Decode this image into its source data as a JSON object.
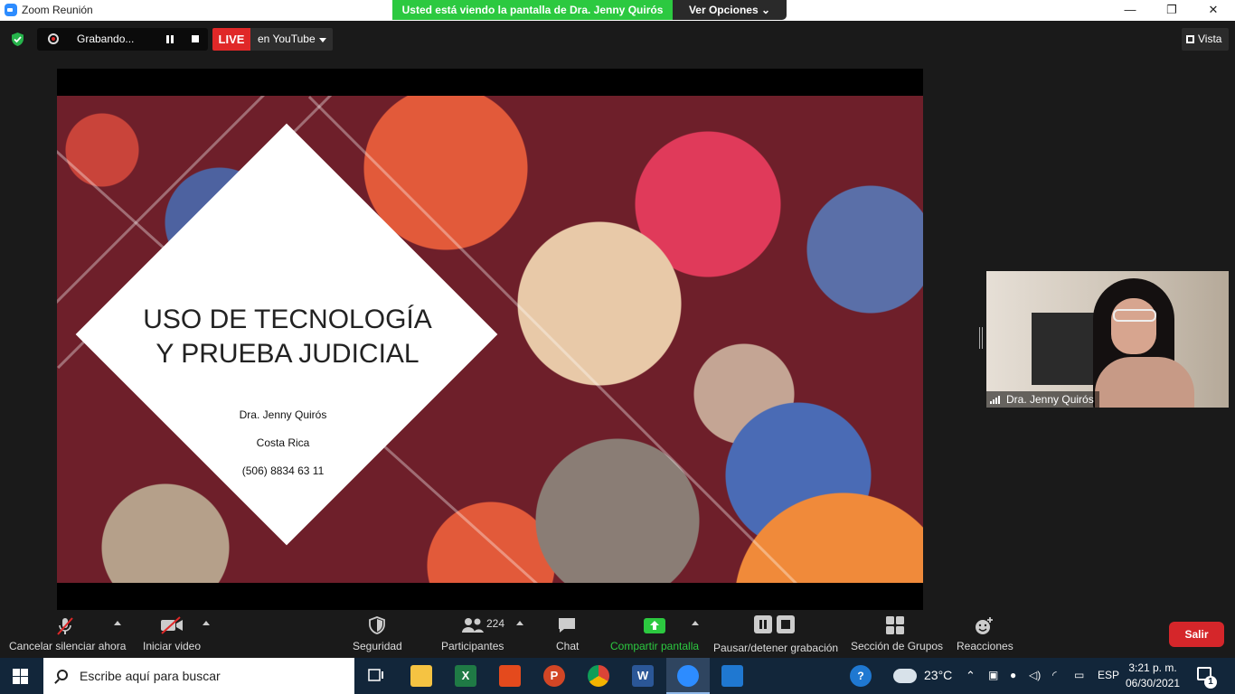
{
  "window": {
    "title": "Zoom Reunión",
    "share_banner": "Usted está viendo la pantalla de Dra. Jenny Quirós",
    "view_options": "Ver Opciones"
  },
  "topbar": {
    "recording_label": "Grabando...",
    "live_label": "LIVE",
    "live_target": "en YouTube",
    "view_label": "Vista"
  },
  "slide": {
    "title_line1": "USO DE TECNOLOGÍA",
    "title_line2": "Y PRUEBA JUDICIAL",
    "author": "Dra. Jenny Quirós",
    "country": "Costa Rica",
    "phone": "(506) 8834 63 11"
  },
  "participant": {
    "name": "Dra. Jenny Quirós"
  },
  "toolbar": {
    "mute_label": "Cancelar silenciar ahora",
    "video_label": "Iniciar video",
    "security_label": "Seguridad",
    "participants_label": "Participantes",
    "participants_count": "224",
    "chat_label": "Chat",
    "share_label": "Compartir pantalla",
    "recording_label": "Pausar/detener grabación",
    "breakout_label": "Sección de Grupos",
    "reactions_label": "Reacciones",
    "leave_label": "Salir"
  },
  "taskbar": {
    "search_placeholder": "Escribe aquí para buscar",
    "weather": "23°C",
    "language": "ESP",
    "time": "3:21 p. m.",
    "date": "06/30/2021",
    "notifications": "1"
  },
  "colors": {
    "share_green": "#2cc940",
    "live_red": "#e02828",
    "leave_red": "#d5262a",
    "taskbar": "#12263a"
  },
  "icons": [
    "zoom-icon",
    "shield-icon",
    "record-icon",
    "pause-icon",
    "stop-icon",
    "microphone-muted-icon",
    "video-muted-icon",
    "security-shield-icon",
    "participants-icon",
    "chat-icon",
    "share-screen-icon",
    "breakout-icon",
    "reactions-icon",
    "windows-start-icon",
    "search-icon",
    "task-view-icon",
    "file-explorer-icon",
    "excel-icon",
    "office-icon",
    "powerpoint-icon",
    "chrome-icon",
    "word-icon",
    "zoom-taskbar-icon",
    "mail-icon",
    "help-icon",
    "weather-icon",
    "notification-icon"
  ]
}
